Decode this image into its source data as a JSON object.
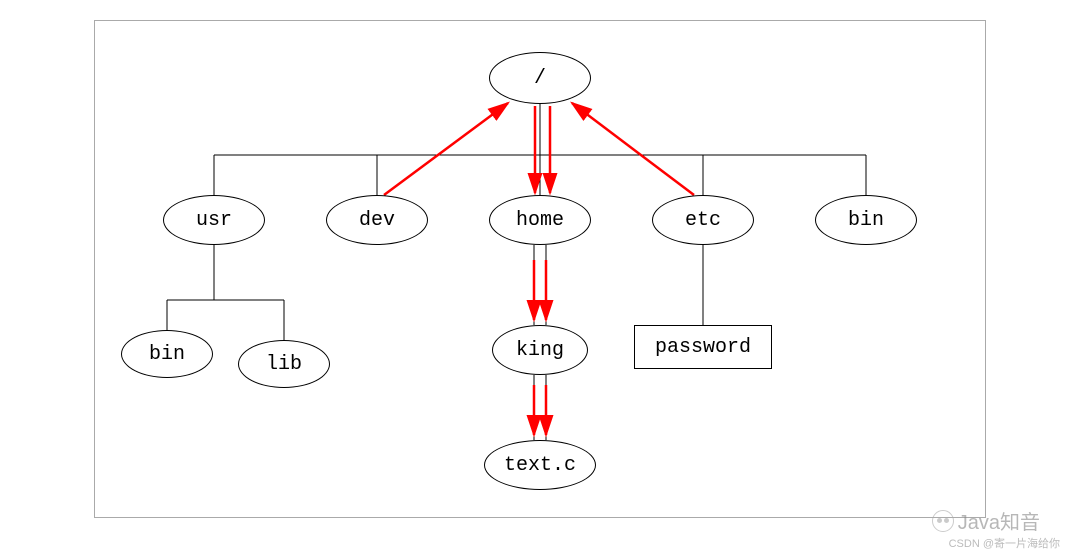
{
  "chart_data": {
    "type": "table",
    "title": "Linux filesystem hierarchy tree",
    "tree": {
      "name": "/",
      "shape": "ellipse",
      "children": [
        {
          "name": "usr",
          "shape": "ellipse",
          "children": [
            {
              "name": "bin",
              "shape": "ellipse"
            },
            {
              "name": "lib",
              "shape": "ellipse"
            }
          ]
        },
        {
          "name": "dev",
          "shape": "ellipse",
          "arrow_to_parent": true
        },
        {
          "name": "home",
          "shape": "ellipse",
          "arrow_from_parent": true,
          "children": [
            {
              "name": "king",
              "shape": "ellipse",
              "arrow_from_parent": true,
              "children": [
                {
                  "name": "text.c",
                  "shape": "ellipse",
                  "arrow_from_parent": true
                }
              ]
            }
          ]
        },
        {
          "name": "etc",
          "shape": "ellipse",
          "arrow_to_parent": true,
          "children": [
            {
              "name": "password",
              "shape": "rect"
            }
          ]
        },
        {
          "name": "bin",
          "shape": "ellipse"
        }
      ]
    }
  },
  "nodes": {
    "root": "/",
    "usr": "usr",
    "dev": "dev",
    "home": "home",
    "etc": "etc",
    "bin_top": "bin",
    "bin_child": "bin",
    "lib": "lib",
    "king": "king",
    "textc": "text.c",
    "password": "password"
  },
  "watermark": {
    "java": "Java知音",
    "csdn": "CSDN @寄一片海给你"
  }
}
